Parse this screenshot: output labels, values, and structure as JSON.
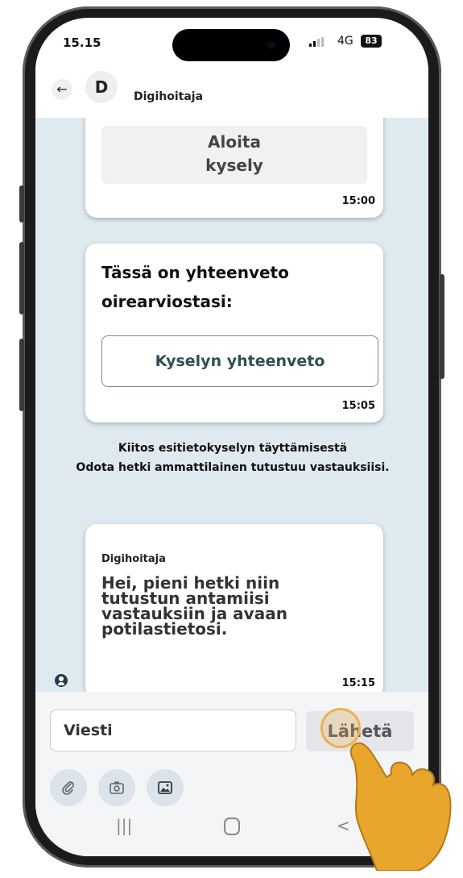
{
  "status_bar": {
    "time": "15.15",
    "network": "4G",
    "battery": "83"
  },
  "app_bar": {
    "back_icon": "arrow-left-icon",
    "avatar_initial": "D",
    "title": "Digihoitaja"
  },
  "messages": [
    {
      "type": "bot",
      "button_label": "Aloita kysely",
      "timestamp": "15:00"
    },
    {
      "type": "bot",
      "text": "Tässä on yhteenveto oirearviostasi:",
      "button_label": "Kyselyn yhteenveto",
      "timestamp": "15:05"
    },
    {
      "type": "system",
      "line1": "Kiitos esitietokyselyn täyttämisestä",
      "line2": "Odota hetki ammattilainen tutustuu vastauksiisi."
    },
    {
      "type": "bot",
      "sender": "Digihoitaja",
      "text": "Hei, pieni hetki niin tutustun antamiisi vastauksiin ja avaan potilastietosi.",
      "timestamp": "15:15"
    }
  ],
  "composer": {
    "placeholder": "Viesti",
    "send_label": "Lähetä",
    "tools": [
      "paperclip-icon",
      "camera-icon",
      "image-icon"
    ]
  },
  "system_nav": {
    "icons": [
      "recent-apps-icon",
      "home-icon",
      "back-chevron-icon"
    ]
  },
  "colors": {
    "chat_bg": "#dfe9f0",
    "accent": "#2f4f55",
    "highlight": "#f1b04a"
  }
}
